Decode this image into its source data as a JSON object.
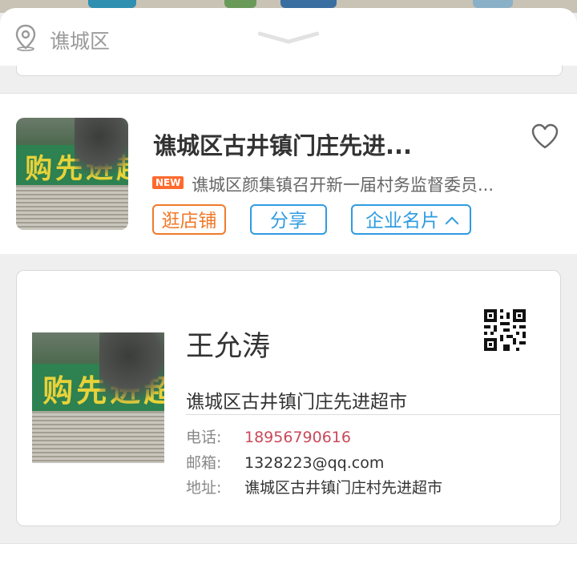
{
  "location": {
    "label": "谯城区"
  },
  "shop": {
    "title": "谯城区古井镇门庄先进...",
    "new_badge": "NEW",
    "news": "谯城区颜集镇召开新一届村务监督委员...",
    "buttons": {
      "visit": "逛店铺",
      "share": "分享",
      "card": "企业名片"
    }
  },
  "business_card": {
    "name": "王允涛",
    "company": "谯城区古井镇门庄先进超市",
    "phone_label": "电话:",
    "phone": "18956790616",
    "email_label": "邮箱:",
    "email": "1328223@qq.com",
    "address_label": "地址:",
    "address": "谯城区古井镇门庄村先进超市"
  },
  "storefront_sign": "购先进超市",
  "colors": {
    "orange": "#f07a2a",
    "blue": "#2f9be0",
    "phone": "#c84a5a",
    "new": "#ff6a2e"
  }
}
